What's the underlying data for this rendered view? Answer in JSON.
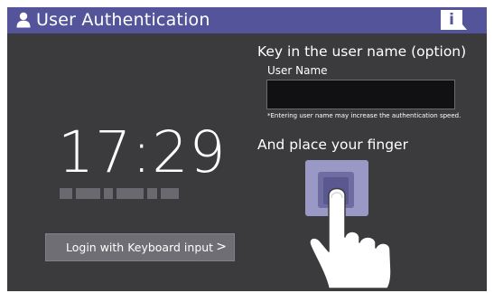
{
  "titlebar": {
    "title": "User Authentication",
    "user_icon": "user-icon",
    "info_icon": "info-icon",
    "info_glyph": "i"
  },
  "clock": {
    "time": "17:29",
    "date_obscured": true
  },
  "keyboard_login": {
    "label": "Login with Keyboard input",
    "chevron": ">"
  },
  "username": {
    "prompt": "Key in the user name (option)",
    "label": "User Name",
    "value": "",
    "note": "*Entering user name may increase the authentication speed."
  },
  "finger": {
    "prompt": "And place your finger",
    "icon": "fingerprint-sensor-hand-icon"
  },
  "colors": {
    "titlebar": "#54549a",
    "background": "#3b3b3d",
    "button": "#6e6e74",
    "sensor": "#9a98c4"
  }
}
